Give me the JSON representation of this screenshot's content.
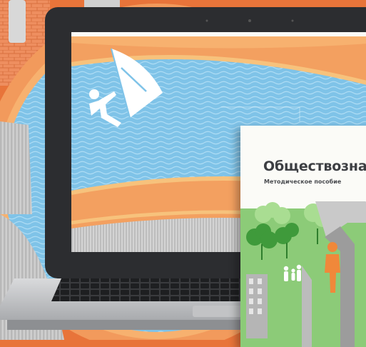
{
  "book": {
    "title": "Обществозна",
    "subtitle": "Методическое пособие"
  },
  "colors": {
    "background": "#e8743a",
    "water": "#7fc3e8",
    "sand": "#f2a063",
    "laptop_frame": "#2c2d30",
    "book_cover": "#fbfbf7",
    "grass": "#7cbd6a",
    "person_highlight": "#f0883a"
  },
  "icons": [
    "windsurfer-icon",
    "family-icon",
    "person-icon"
  ]
}
